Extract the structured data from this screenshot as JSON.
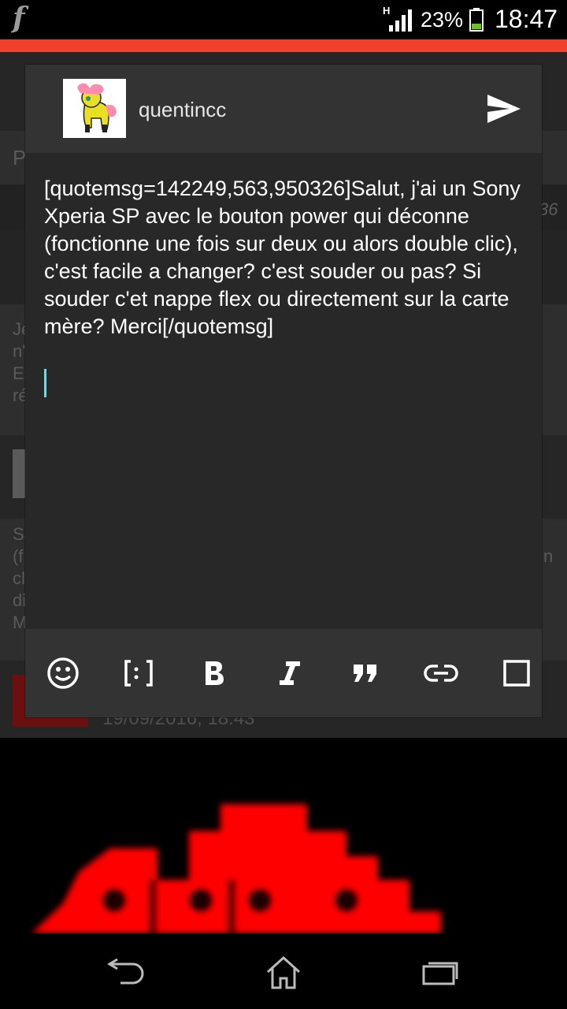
{
  "status_bar": {
    "app_logo": "f",
    "network_type": "H",
    "battery_percent": "23%",
    "time": "18:47",
    "icons": [
      "signal-icon",
      "battery-icon"
    ]
  },
  "background": {
    "partial_texts": [
      "P",
      "36",
      "Je",
      "n'",
      "Es",
      "ré",
      "Sa",
      "(f",
      "cl",
      "di",
      "M",
      "n"
    ],
    "date": "19/09/2016, 18:43"
  },
  "dialog": {
    "username": "quentincc",
    "message": "[quotemsg=142249,563,950326]Salut, j'ai un Sony Xperia SP avec le bouton power qui déconne (fonctionne une fois sur deux ou alors double clic), c'est facile a changer? c'est souder ou pas? Si souder c'et nappe flex ou directement sur la carte mère? Merci[/quotemsg]",
    "send_icon": "send-icon",
    "toolbar_icons": [
      "emoji-icon",
      "spoiler-icon",
      "bold-icon",
      "italic-icon",
      "quote-icon",
      "link-icon",
      "square-icon"
    ]
  },
  "navbar": {
    "icons": [
      "back-icon",
      "home-icon",
      "recent-apps-icon"
    ]
  },
  "colors": {
    "accent": "#f0412f",
    "cursor": "#7fd3d6",
    "dialog_bg": "#282828",
    "dialog_bar": "#333333"
  }
}
